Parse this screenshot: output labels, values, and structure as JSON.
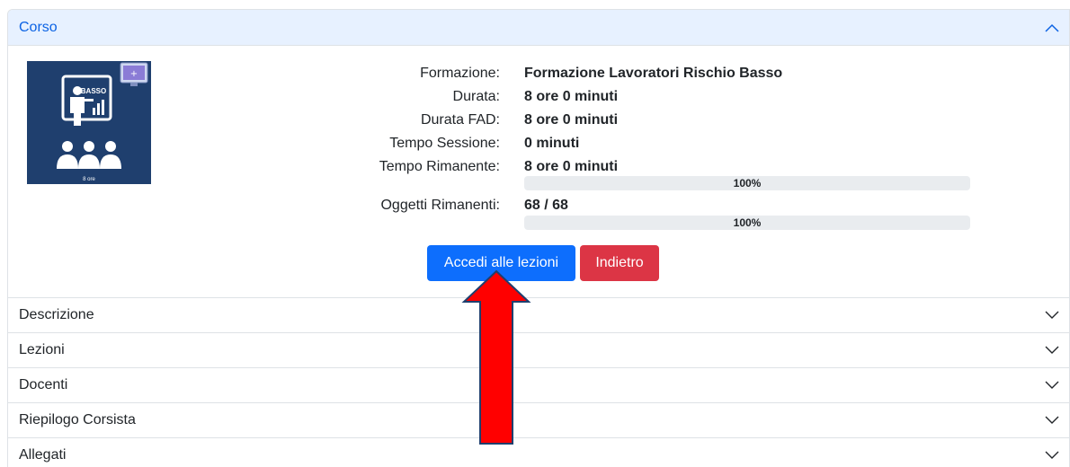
{
  "course": {
    "header": "Corso",
    "thumbnail": {
      "badge": "BASSO",
      "caption": "8 ore"
    },
    "fields": [
      {
        "label": "Formazione:",
        "value": "Formazione Lavoratori Rischio Basso"
      },
      {
        "label": "Durata:",
        "value": "8 ore 0 minuti"
      },
      {
        "label": "Durata FAD:",
        "value": "8 ore 0 minuti"
      },
      {
        "label": "Tempo Sessione:",
        "value": "0 minuti"
      },
      {
        "label": "Tempo Rimanente:",
        "value": "8 ore 0 minuti"
      },
      {
        "label": "Oggetti Rimanenti:",
        "value": "68 / 68"
      }
    ],
    "progress": [
      {
        "label": "100%",
        "percent": 100
      },
      {
        "label": "100%",
        "percent": 100
      }
    ],
    "buttons": {
      "access": "Accedi alle lezioni",
      "back": "Indietro"
    }
  },
  "sections": [
    {
      "label": "Descrizione"
    },
    {
      "label": "Lezioni"
    },
    {
      "label": "Docenti"
    },
    {
      "label": "Riepilogo Corsista"
    },
    {
      "label": "Allegati"
    }
  ],
  "colors": {
    "primary": "#0d6efd",
    "danger": "#dc3545",
    "header_bg": "#e7f1ff",
    "arrow": "#ff0000"
  }
}
